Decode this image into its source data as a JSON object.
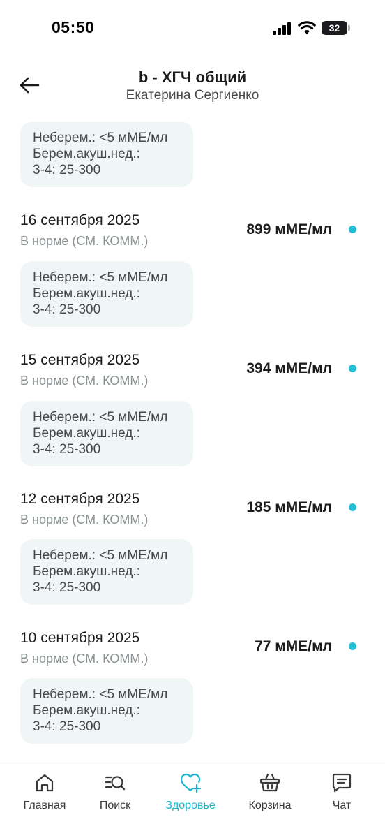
{
  "status_bar": {
    "time": "05:50",
    "battery": "32"
  },
  "header": {
    "title": "b - ХГЧ общий",
    "subtitle": "Екатерина Сергиенко"
  },
  "reference_note": {
    "lines": [
      "Неберем.: <5 мМЕ/мл",
      "Берем.акуш.нед.:",
      "3-4: 25-300"
    ]
  },
  "entries": [
    {
      "date": "16 сентября 2025",
      "status": "В норме (СМ. КОММ.)",
      "value": "899 мМЕ/мл"
    },
    {
      "date": "15 сентября 2025",
      "status": "В норме (СМ. КОММ.)",
      "value": "394 мМЕ/мл"
    },
    {
      "date": "12 сентября 2025",
      "status": "В норме (СМ. КОММ.)",
      "value": "185 мМЕ/мл"
    },
    {
      "date": "10 сентября 2025",
      "status": "В норме (СМ. КОММ.)",
      "value": "77 мМЕ/мл"
    }
  ],
  "colors": {
    "accent": "#1bb7d1",
    "normal_dot": "#22bfd6"
  },
  "bottom_nav": {
    "items": [
      {
        "label": "Главная",
        "icon": "home-icon",
        "active": false
      },
      {
        "label": "Поиск",
        "icon": "search-icon",
        "active": false
      },
      {
        "label": "Здоровье",
        "icon": "heart-plus-icon",
        "active": true
      },
      {
        "label": "Корзина",
        "icon": "basket-icon",
        "active": false
      },
      {
        "label": "Чат",
        "icon": "chat-icon",
        "active": false
      }
    ]
  }
}
